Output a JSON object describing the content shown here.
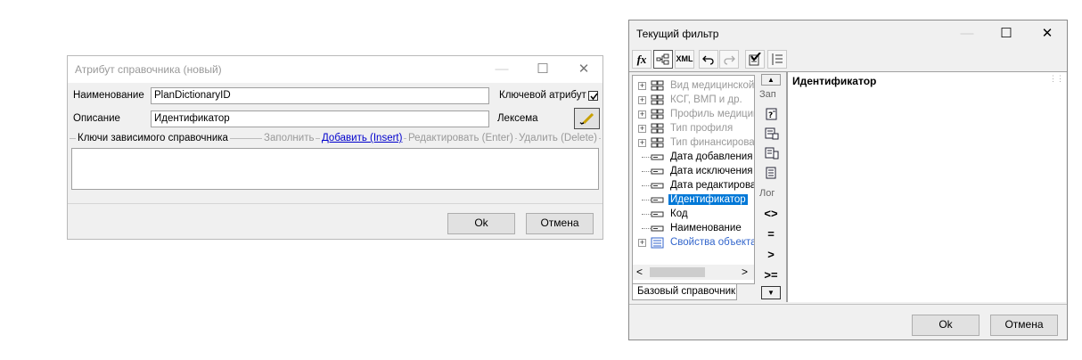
{
  "dialog1": {
    "title": "Атрибут справочника (новый)",
    "name_label": "Наименование",
    "name_value": "PlanDictionaryID",
    "key_attr_label": "Ключевой атрибут",
    "key_attr_checked": true,
    "desc_label": "Описание",
    "desc_value": "Идентификатор",
    "lexeme_label": "Лексема",
    "lexeme_button_icon": "pencil-icon",
    "group_label": "Ключи зависимого справочника",
    "fill_link": "Заполнить",
    "add_link": "Добавить (Insert)",
    "edit_link": "Редактировать (Enter)",
    "delete_link": "Удалить (Delete)",
    "ok_label": "Ok",
    "cancel_label": "Отмена"
  },
  "dialog2": {
    "title": "Текущий фильтр",
    "toolbar": [
      "fx",
      "tree",
      "XML",
      "undo",
      "redo",
      "check",
      "list"
    ],
    "tree_items": [
      {
        "label": "Вид медицинской",
        "type": "table",
        "expandable": true,
        "enabled": false
      },
      {
        "label": "КСГ, ВМП и др.",
        "type": "table",
        "expandable": true,
        "enabled": false
      },
      {
        "label": "Профиль медицин",
        "type": "table",
        "expandable": true,
        "enabled": false
      },
      {
        "label": "Тип профиля",
        "type": "table",
        "expandable": true,
        "enabled": false
      },
      {
        "label": "Тип финансирова",
        "type": "table",
        "expandable": true,
        "enabled": false
      },
      {
        "label": "Дата добавления",
        "type": "field",
        "expandable": false,
        "enabled": true
      },
      {
        "label": "Дата исключения",
        "type": "field",
        "expandable": false,
        "enabled": true
      },
      {
        "label": "Дата редактирова",
        "type": "field",
        "expandable": false,
        "enabled": true
      },
      {
        "label": "Идентификатор",
        "type": "field",
        "expandable": false,
        "enabled": true,
        "selected": true
      },
      {
        "label": "Код",
        "type": "field",
        "expandable": false,
        "enabled": true
      },
      {
        "label": "Наименование",
        "type": "field",
        "expandable": false,
        "enabled": true
      },
      {
        "label": "Свойства объекта",
        "type": "object",
        "expandable": true,
        "enabled": true,
        "link": true
      }
    ],
    "tab_label": "Базовый справочник",
    "section_query": "Зап",
    "section_logic": "Лог",
    "operators": [
      "<>",
      "=",
      ">",
      ">="
    ],
    "editor_text": "Идентификатор",
    "ok_label": "Ok",
    "cancel_label": "Отмена"
  },
  "colors": {
    "selection": "#0078d7",
    "link": "#0000cc",
    "tree_link": "#3366cc"
  }
}
